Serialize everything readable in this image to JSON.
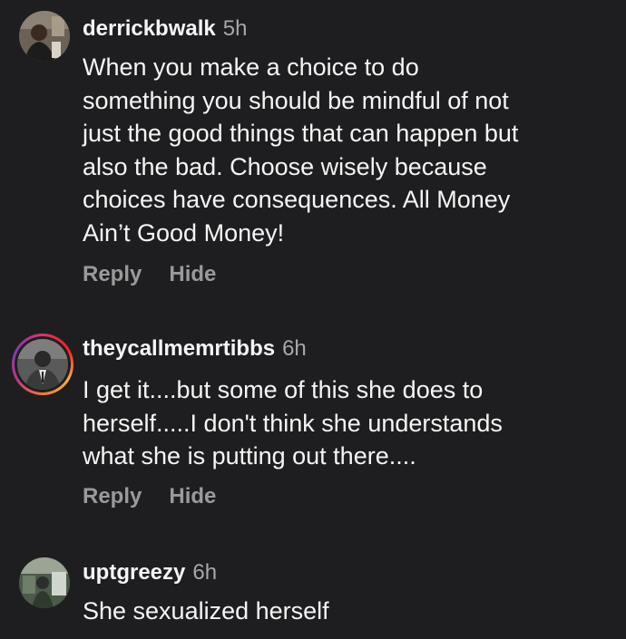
{
  "comments": [
    {
      "username": "derrickbwalk",
      "time": "5h",
      "text": "When you make a choice to do\nsomething you should be mindful of not\njust the good things that can happen but\nalso the bad. Choose wisely because\nchoices have consequences. All Money\nAin’t Good Money!",
      "reply_label": "Reply",
      "hide_label": "Hide"
    },
    {
      "username": "theycallmemrtibbs",
      "time": "6h",
      "text": "I get it....but some of this she does to\nherself.....I don't think she understands\nwhat she is putting out there....",
      "reply_label": "Reply",
      "hide_label": "Hide"
    },
    {
      "username": "uptgreezy",
      "time": "6h",
      "text": "She sexualized herself"
    }
  ]
}
